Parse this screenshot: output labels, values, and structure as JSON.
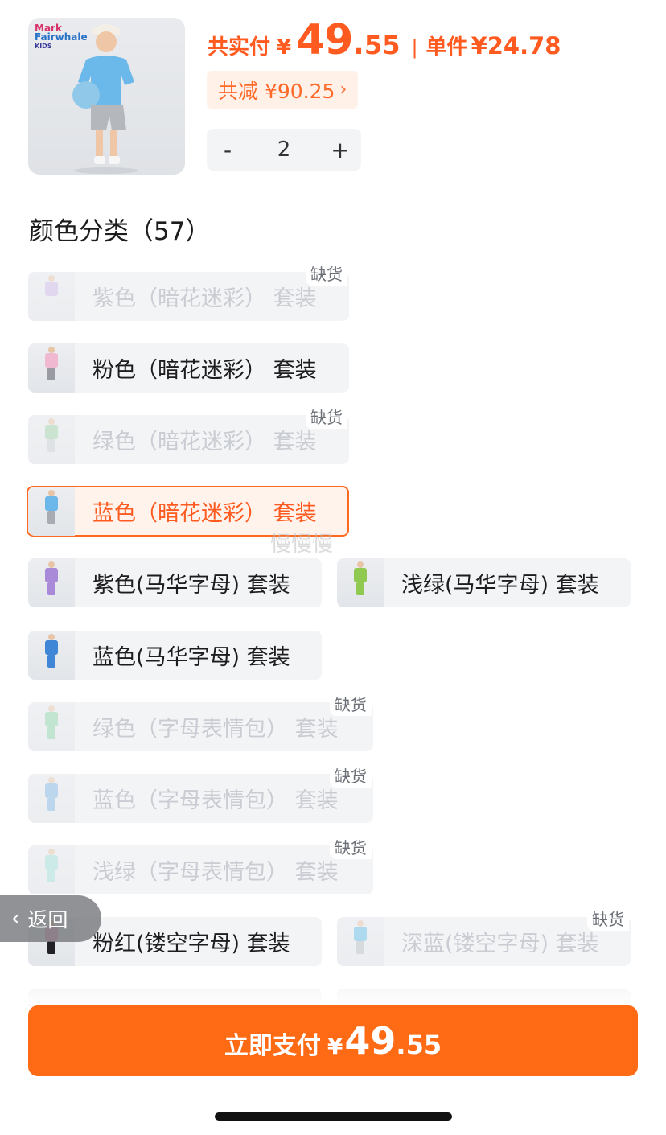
{
  "product": {
    "brand_logo": {
      "line1": "Mark",
      "line2": "Fairwhale",
      "line3": "KIDS"
    }
  },
  "price": {
    "label": "共实付",
    "currency": "¥",
    "integer": "49",
    "dot": ".",
    "decimal": "55",
    "separator": "|",
    "unit_label": "单件",
    "unit_price": "¥24.78"
  },
  "discount": {
    "text": "共减 ¥90.25",
    "chevron": "›"
  },
  "quantity": {
    "minus": "-",
    "value": "2",
    "plus": "+"
  },
  "section": {
    "title": "颜色分类（57）"
  },
  "sku_options": [
    {
      "label": "紫色（暗花迷彩） 套装",
      "tag": "缺货",
      "state": "oos",
      "shirt": "#cdb8e8",
      "shorts": "#e9e9ee"
    },
    {
      "label": "粉色（暗花迷彩） 套装",
      "tag": "",
      "state": "normal",
      "shirt": "#f1b8d2",
      "shorts": "#9a9aa2"
    },
    {
      "label": "绿色（暗花迷彩） 套装",
      "tag": "缺货",
      "state": "oos",
      "shirt": "#9ccfa6",
      "shorts": "#c8ced0"
    },
    {
      "label": "蓝色（暗花迷彩） 套装",
      "tag": "",
      "state": "selected",
      "shirt": "#6cb7ea",
      "shorts": "#a8acb2"
    },
    {
      "label": "紫色(马华字母) 套装",
      "tag": "",
      "state": "normal",
      "shirt": "#a88ad8",
      "shorts": "#a88ad8"
    },
    {
      "label": "浅绿(马华字母) 套装",
      "tag": "",
      "state": "normal",
      "shirt": "#8fc94f",
      "shorts": "#8fc94f"
    },
    {
      "label": "蓝色(马华字母) 套装",
      "tag": "",
      "state": "normal",
      "shirt": "#3f86d6",
      "shorts": "#3f86d6"
    },
    {
      "label": "绿色（字母表情包） 套装",
      "tag": "缺货",
      "state": "oos",
      "shirt": "#86d3a3",
      "shorts": "#86d3a3"
    },
    {
      "label": "蓝色（字母表情包） 套装",
      "tag": "缺货",
      "state": "oos",
      "shirt": "#7ab3e6",
      "shorts": "#7ab3e6"
    },
    {
      "label": "浅绿（字母表情包） 套装",
      "tag": "缺货",
      "state": "oos",
      "shirt": "#9fe0d6",
      "shorts": "#9fe0d6"
    },
    {
      "label": "粉红(镂空字母) 套装",
      "tag": "",
      "state": "normal",
      "shirt": "#f09ac0",
      "shorts": "#222226"
    },
    {
      "label": "深蓝(镂空字母) 套装",
      "tag": "缺货",
      "state": "oos",
      "shirt": "#5bbbe8",
      "shorts": "#b9bdc2"
    }
  ],
  "watermark": "慢慢慢",
  "back": {
    "chevron": "‹",
    "label": "返回"
  },
  "pay_button": {
    "label": "立即支付",
    "currency": "¥",
    "integer": "49",
    "decimal": ".55"
  }
}
